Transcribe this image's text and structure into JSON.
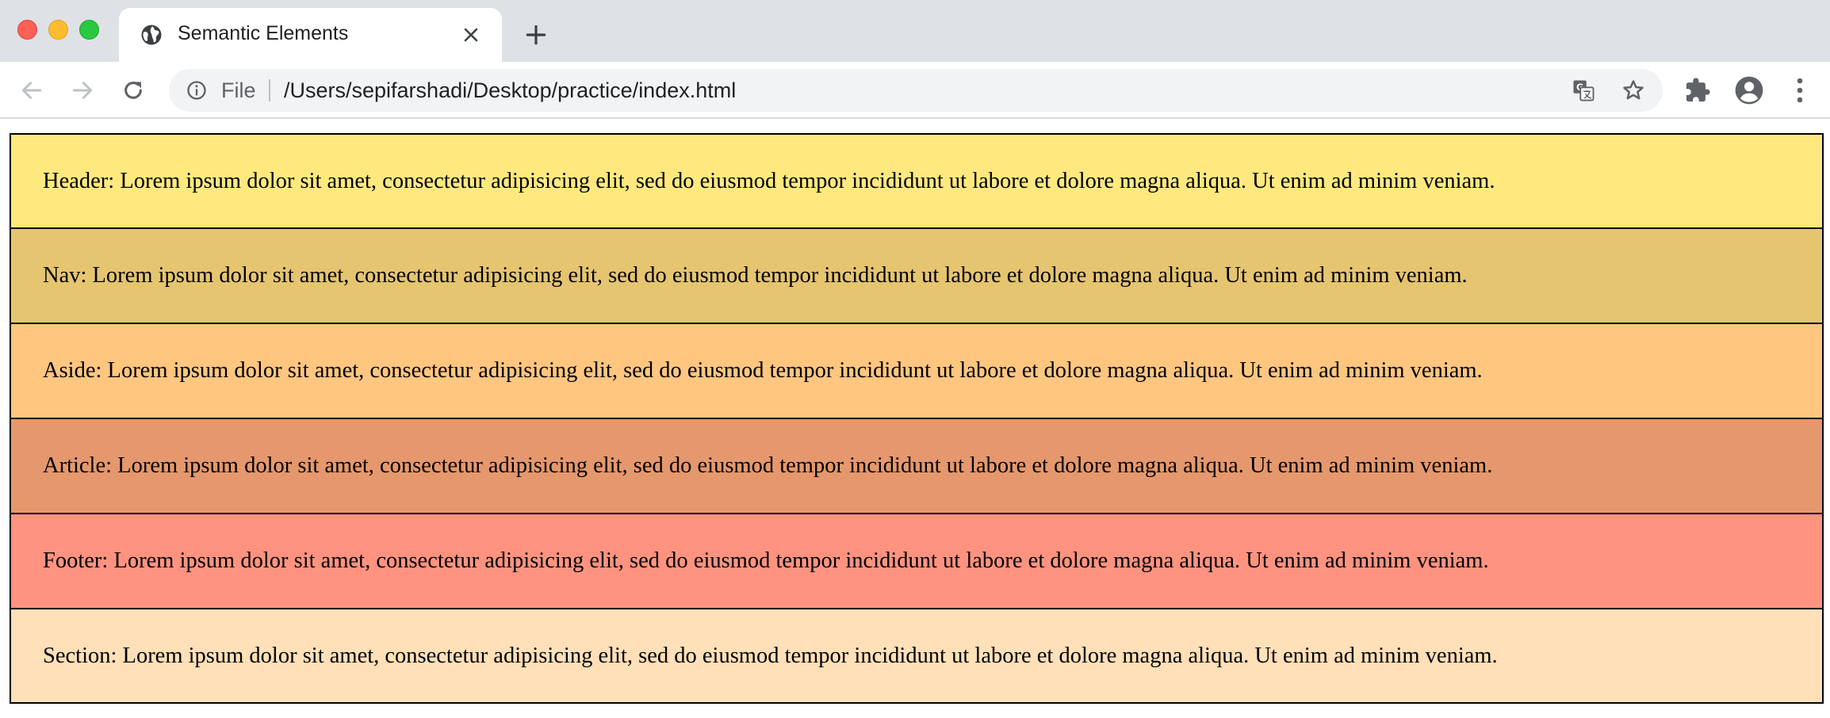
{
  "tab": {
    "title": "Semantic Elements"
  },
  "address_bar": {
    "scheme_label": "File",
    "url": "/Users/sepifarshadi/Desktop/practice/index.html"
  },
  "icons": {
    "favicon": "globe-icon",
    "close": "close-icon",
    "new_tab": "plus-icon",
    "back": "back-arrow-icon",
    "forward": "forward-arrow-icon",
    "reload": "reload-icon",
    "info": "info-icon",
    "translate": "translate-icon",
    "bookmark": "star-icon",
    "extensions": "puzzle-icon",
    "profile": "account-icon",
    "menu": "kebab-menu-icon"
  },
  "colors": {
    "header": "#ffe97f",
    "nav": "#e6c570",
    "aside": "#ffc680",
    "article": "#e5986d",
    "footer": "#ff9380",
    "section": "#ffe0b8"
  },
  "blocks": [
    {
      "text": "Header: Lorem ipsum dolor sit amet, consectetur adipisicing elit, sed do eiusmod tempor incididunt ut labore et dolore magna aliqua. Ut enim ad minim veniam."
    },
    {
      "text": "Nav: Lorem ipsum dolor sit amet, consectetur adipisicing elit, sed do eiusmod tempor incididunt ut labore et dolore magna aliqua. Ut enim ad minim veniam."
    },
    {
      "text": "Aside: Lorem ipsum dolor sit amet, consectetur adipisicing elit, sed do eiusmod tempor incididunt ut labore et dolore magna aliqua. Ut enim ad minim veniam."
    },
    {
      "text": "Article: Lorem ipsum dolor sit amet, consectetur adipisicing elit, sed do eiusmod tempor incididunt ut labore et dolore magna aliqua. Ut enim ad minim veniam."
    },
    {
      "text": "Footer: Lorem ipsum dolor sit amet, consectetur adipisicing elit, sed do eiusmod tempor incididunt ut labore et dolore magna aliqua. Ut enim ad minim veniam."
    },
    {
      "text": "Section: Lorem ipsum dolor sit amet, consectetur adipisicing elit, sed do eiusmod tempor incididunt ut labore et dolore magna aliqua. Ut enim ad minim veniam."
    }
  ]
}
